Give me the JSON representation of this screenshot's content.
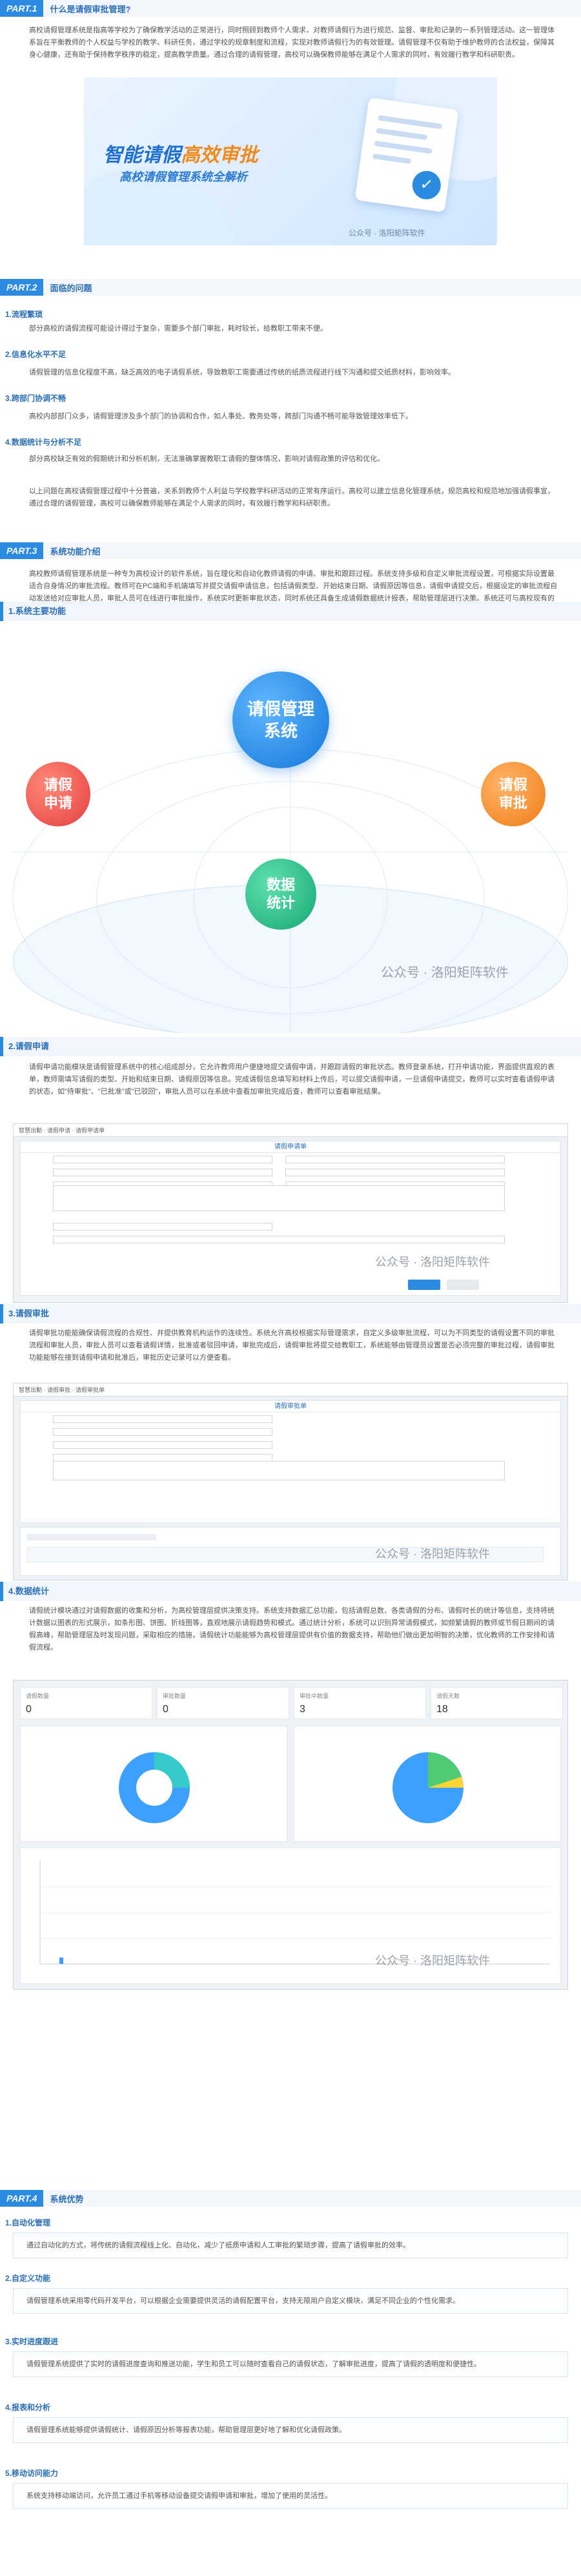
{
  "part1": {
    "tag": "PART.1",
    "title": "什么是请假审批管理?",
    "para": "高校请假管理系统是指高等学校为了确保教学活动的正常进行，同时照顾到教师个人需求，对教师请假行为进行规范、监督、审批和记录的一系列管理活动。这一管理体系旨在平衡教师的个人权益与学校的教学、科研任务，通过学校的规章制度和流程，实现对教师请假行为的有效管理。请假管理不仅有助于维护教师的合法权益，保障其身心健康，还有助于保持教学秩序的稳定，提高教学质量。通过合理的请假管理，高校可以确保教师能够在满足个人需求的同时，有效履行教学和科研职责。",
    "banner_line1a": "智能请假",
    "banner_line1b": "高效审批",
    "banner_line2": "高校请假管理系统全解析",
    "banner_footer": "公众号 · 洛阳矩阵软件"
  },
  "part2": {
    "tag": "PART.2",
    "title": "面临的问题",
    "items": [
      {
        "num": "1.流程繁琐",
        "text": "部分高校的请假流程可能设计得过于复杂，需要多个部门审批，耗时较长，给教职工带来不便。"
      },
      {
        "num": "2.信息化水平不足",
        "text": "请假管理的信息化程度不高，缺乏高效的电子请假系统，导致教职工需要通过传统的纸质流程进行线下沟通和提交纸质材料，影响效率。"
      },
      {
        "num": "3.跨部门协调不畅",
        "text": "高校内部部门众多，请假管理涉及多个部门的协调和合作，如人事处、教务处等，跨部门沟通不畅可能导致管理效率低下。"
      },
      {
        "num": "4.数据统计与分析不足",
        "text": "部分高校缺乏有效的假期统计和分析机制，无法准确掌握教职工请假的整体情况，影响对请假政策的评估和优化。"
      }
    ],
    "summary": "以上问题在高校请假管理过程中十分普遍，关系到教师个人利益与学校教学科研活动的正常有序运行。高校可以建立信息化管理系统，规范高校和规范地加强请假事宜，通过合理的请假管理，高校可以确保教师能够在满足个人需求的同时，有效履行教学和科研职责。"
  },
  "part3": {
    "tag": "PART.3",
    "title": "系统功能介绍",
    "intro": "高校教师请假管理系统是一种专为高校设计的软件系统，旨在理化和自动化教师请假的申请、审批和跟踪过程。系统支持多级和自定义审批流程设置，可根据实际设置最适合自身情况的审批流程。教师可在PC端和手机端填写并提交请假申请信息，包括请假类型、开始结束日期、请假原因等信息，请假申请提交后，根据设定的审批流程自动发送给对应审批人员，审批人员可在线进行审批操作，系统实时更新审批状态，同时系统还具备生成请假数据统计报表，帮助管理层进行决策。系统还可与高校现有的教务系统、中心等等进行集成，实现数据共享和流程协同。",
    "s1": {
      "label": "1.系统主要功能",
      "center": "请假管理\n系统",
      "left": "请假\n申请",
      "right": "请假\n审批",
      "bottom": "数据\n统计",
      "wm": "公众号 · 洛阳矩阵软件"
    },
    "s2": {
      "label": "2.请假申请",
      "text": "请假申请功能模块是请假管理系统中的核心组成部分，它允许教师用户便捷地提交请假申请，并跟踪请假的审批状态。教师登录系统，打开申请功能，界面提供直观的表单，教师需填写请假的类型、开始和结束日期、请假原因等信息。完成请假信息填写和材料上传后，可以提交请假申请，一旦请假申请提交，教师可以实时查看请假申请的状态，如\"待审批\"、\"已批准\"或\"已驳回\"，审批人员可以在系统中查看加审批完成后查，教师可以查看审批结果。",
      "scr_title": "请假申请单",
      "scr_bar": "智慧出勤 · 请假申请 · 请假申请单",
      "wm": "公众号 · 洛阳矩阵软件"
    },
    "s3": {
      "label": "3.请假审批",
      "text": "请假审批功能能确保请假流程的合规性、并提供教育机构运作的连续性。系统允许高校根据实际管理需求，自定义多级审批流程，可以为不同类型的请假设置不同的审批流程和审批人员，审批人员可以查看请假详情，批准或者驳回申请，审批完成后，请假审批将提交给教职工，系统能够由管理员设置是否必须完整的审批过程，请假审批功能能够在接到请假申请和批准后，审批历史记录可以方便查看。",
      "scr_title": "请假审批单",
      "scr_bar": "智慧出勤 · 请假审批 · 请假审批单",
      "wm": "公众号 · 洛阳矩阵软件"
    },
    "s4": {
      "label": "4.数据统计",
      "text": "请假统计模块通过对请假数据的收集和分析，为高校管理层提供决策支持。系统支持数据汇总功能，包括请假总数、各类请假的分布、请假时长的统计等信息，支持将统计数据以图表的形式展示，如条形图、饼图、折线图等，直观地展示请假趋势和模式。通过统计分析，系统可以识别异常请假模式，如频繁请假的教师或节假日期间的请假高峰，帮助管理层及时发现问题，采取相应的措施，请假统计功能能够为高校管理层提供有价值的数据支持，帮助他们做出更加明智的决策，优化教师的工作安排和请假流程。",
      "kpis": [
        {
          "k": "请假数量",
          "v": "0"
        },
        {
          "k": "审批数量",
          "v": "0"
        },
        {
          "k": "审批中数量",
          "v": "3"
        },
        {
          "k": "请假天数",
          "v": "18"
        }
      ],
      "wm": "公众号 · 洛阳矩阵软件"
    }
  },
  "part4": {
    "tag": "PART.4",
    "title": "系统优势",
    "items": [
      {
        "num": "1.自动化管理",
        "text": "通过自动化的方式，将传统的请假流程线上化、自动化，减少了纸质申请和人工审批的繁琐步骤，提高了请假审批的效率。"
      },
      {
        "num": "2.自定义功能",
        "text": "请假管理系统采用零代码开发平台，可以根据企业需要提供灵活的请假配置平台，支持无限用户自定义模块，满足不同企业的个性化需求。"
      },
      {
        "num": "3.实时进度跟进",
        "text": "请假管理系统提供了实时的请假进度查询和推送功能，学生和员工可以随时查看自己的请假状态，了解审批进度，提高了请假的透明度和便捷性。"
      },
      {
        "num": "4.报表和分析",
        "text": "请假管理系统能够提供请假统计、请假原因分析等报表功能，帮助管理层更好地了解和优化请假政策。"
      },
      {
        "num": "5.移动访问能力",
        "text": "系统支持移动端访问，允许员工通过手机等移动设备提交请假申请和审批，增加了使用的灵活性。"
      }
    ]
  }
}
